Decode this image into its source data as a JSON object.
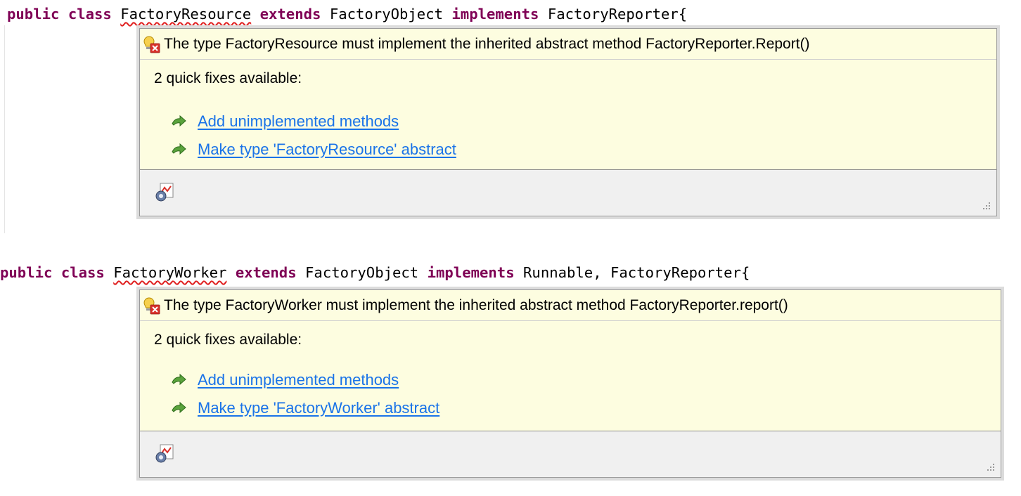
{
  "editor": {
    "snippets": [
      {
        "code": {
          "kw_public": "public",
          "kw_class": "class",
          "class_name": "FactoryResource",
          "kw_extends": "extends",
          "superclass": "FactoryObject",
          "kw_implements": "implements",
          "interfaces": "FactoryReporter{"
        },
        "hover": {
          "error_icon": "problem-bulb-error-icon",
          "message": "The type FactoryResource must implement the inherited abstract method FactoryReporter.Report()",
          "fixes_title": "2 quick fixes available:",
          "fixes": [
            {
              "icon": "quick-fix-arrow-icon",
              "label": "Add unimplemented methods"
            },
            {
              "icon": "quick-fix-arrow-icon",
              "label": "Make type 'FactoryResource' abstract"
            }
          ],
          "toolbar_icon": "configure-problem-severity-icon"
        }
      },
      {
        "code": {
          "kw_public": "public",
          "kw_class": "class",
          "class_name": "FactoryWorker",
          "kw_extends": "extends",
          "superclass": "FactoryObject",
          "kw_implements": "implements",
          "interfaces": "Runnable, FactoryReporter{"
        },
        "hover": {
          "error_icon": "problem-bulb-error-icon",
          "message": "The type FactoryWorker must implement the inherited abstract method FactoryReporter.report()",
          "fixes_title": "2 quick fixes available:",
          "fixes": [
            {
              "icon": "quick-fix-arrow-icon",
              "label": "Add unimplemented methods"
            },
            {
              "icon": "quick-fix-arrow-icon",
              "label": "Make type 'FactoryWorker' abstract"
            }
          ],
          "toolbar_icon": "configure-problem-severity-icon"
        }
      }
    ]
  },
  "colors": {
    "keyword": "#7f0055",
    "link": "#1a73e8",
    "hover_background": "#fdfde0",
    "error_underline": "#e02020"
  }
}
